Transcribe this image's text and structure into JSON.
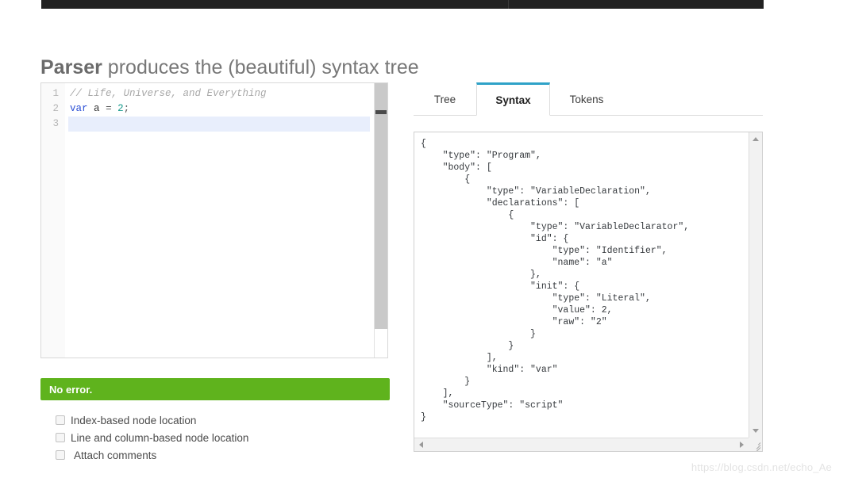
{
  "topbar": {
    "present": true
  },
  "header": {
    "title_strong": "Parser",
    "title_rest": " produces the (beautiful) syntax tree"
  },
  "editor": {
    "lines": [
      {
        "number": "1",
        "text": "// Life, Universe, and Everything",
        "kind": "comment",
        "active": false
      },
      {
        "number": "2",
        "text": "var a = 2;",
        "kind": "code",
        "active": false
      },
      {
        "number": "3",
        "text": "",
        "kind": "code",
        "active": true
      }
    ],
    "line2_tokens": {
      "keyword": "var",
      "space1": " ",
      "identifier": "a",
      "space2": " ",
      "operator": "=",
      "space3": " ",
      "number": "2",
      "punctuation": ";"
    }
  },
  "status": {
    "label": "No error.",
    "color": "#5fb31d"
  },
  "options": [
    {
      "label": "Index-based node location",
      "checked": false
    },
    {
      "label": "Line and column-based node location",
      "checked": false
    },
    {
      "label": "Attach comments",
      "checked": false
    }
  ],
  "tabs": [
    {
      "label": "Tree",
      "active": false
    },
    {
      "label": "Syntax",
      "active": true
    },
    {
      "label": "Tokens",
      "active": false
    }
  ],
  "output": {
    "json": "{\n    \"type\": \"Program\",\n    \"body\": [\n        {\n            \"type\": \"VariableDeclaration\",\n            \"declarations\": [\n                {\n                    \"type\": \"VariableDeclarator\",\n                    \"id\": {\n                        \"type\": \"Identifier\",\n                        \"name\": \"a\"\n                    },\n                    \"init\": {\n                        \"type\": \"Literal\",\n                        \"value\": 2,\n                        \"raw\": \"2\"\n                    }\n                }\n            ],\n            \"kind\": \"var\"\n        }\n    ],\n    \"sourceType\": \"script\"\n}"
  },
  "scrollbars": {
    "editor_vertical": "editor-vertical-scrollbar",
    "output_vertical": "output-vertical-scrollbar",
    "output_horizontal": "output-horizontal-scrollbar"
  },
  "watermark": {
    "text": "https://blog.csdn.net/echo_Ae"
  },
  "colors": {
    "accent_blue": "#2fa2c8",
    "status_green": "#5fb31d",
    "title_gray": "#777777",
    "keyword_blue": "#2b4fd6",
    "number_teal": "#179a8c",
    "comment_gray": "#a8a8a8",
    "active_line": "#e8eefc"
  }
}
